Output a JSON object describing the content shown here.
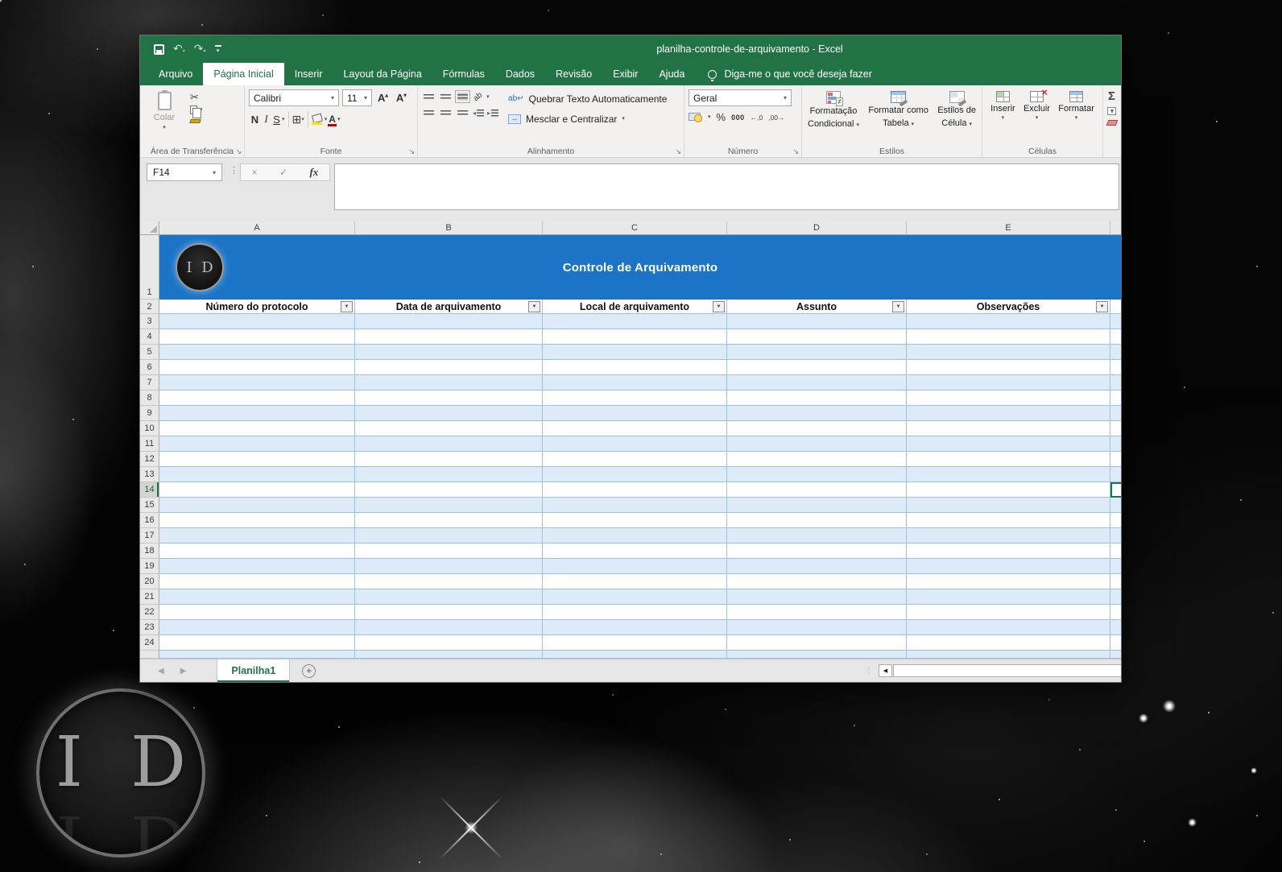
{
  "background": {
    "logo_text": "I D"
  },
  "window": {
    "title": "planilha-controle-de-arquivamento  -  Excel",
    "tabs": [
      "Arquivo",
      "Página Inicial",
      "Inserir",
      "Layout da Página",
      "Fórmulas",
      "Dados",
      "Revisão",
      "Exibir",
      "Ajuda"
    ],
    "active_tab": "Página Inicial",
    "tell_me": "Diga-me o que você deseja fazer"
  },
  "ribbon": {
    "clipboard": {
      "paste_label": "Colar",
      "group_label": "Área de Transferência"
    },
    "font": {
      "font_name": "Calibri",
      "font_size": "11",
      "bold": "N",
      "italic": "I",
      "underline": "S",
      "group_label": "Fonte"
    },
    "alignment": {
      "wrap_label": "Quebrar Texto Automaticamente",
      "merge_label": "Mesclar e Centralizar",
      "group_label": "Alinhamento"
    },
    "number": {
      "format": "Geral",
      "percent": "%",
      "thousands": "000",
      "group_label": "Número"
    },
    "styles": {
      "conditional_line1": "Formatação",
      "conditional_line2": "Condicional",
      "table_line1": "Formatar como",
      "table_line2": "Tabela",
      "cell_line1": "Estilos de",
      "cell_line2": "Célula",
      "group_label": "Estilos"
    },
    "cells": {
      "insert": "Inserir",
      "delete": "Excluir",
      "format": "Formatar",
      "group_label": "Células"
    },
    "edge": {
      "autosum": "Σ"
    }
  },
  "formula_bar": {
    "name_box": "F14",
    "cancel": "×",
    "enter": "✓",
    "fx": "fx",
    "value": ""
  },
  "sheet": {
    "column_letters": [
      "A",
      "B",
      "C",
      "D",
      "E"
    ],
    "banner_title": "Controle de Arquivamento",
    "banner_logo_text": "I D",
    "headers": [
      "Número do protocolo",
      "Data de arquivamento",
      "Local de arquivamento",
      "Assunto",
      "Observações"
    ],
    "row_numbers": [
      "1",
      "2",
      "3",
      "4",
      "5",
      "6",
      "7",
      "8",
      "9",
      "10",
      "11",
      "12",
      "13",
      "14",
      "15",
      "16",
      "17",
      "18",
      "19",
      "20",
      "21",
      "22",
      "23",
      "24"
    ],
    "active_cell": "F14",
    "active_row": "14"
  },
  "sheet_tabs": {
    "active_sheet": "Planilha1",
    "add_sheet": "+"
  },
  "icons": {
    "undo": "↶",
    "redo": "↷",
    "dropdown": "▾",
    "scissors": "✂",
    "orientation": "ab",
    "wrap": "ab↵",
    "merge_arrows": "↔",
    "dec_increase": "←,0",
    "dec_decrease": ",00→",
    "filter": "▼",
    "launcher": "↘",
    "nav_left": "◀",
    "nav_right": "▶",
    "scroll_left": "◀",
    "dots": "⋮",
    "delete_x": "×",
    "indent_left": "◂",
    "indent_right": "▸"
  },
  "colors": {
    "excel_green": "#217346",
    "banner_blue": "#1b74c6",
    "band_blue": "#dcebf7",
    "grid_border_blue": "#9bc2e6",
    "fill_yellow": "#ffe400",
    "font_red": "#c00000"
  }
}
